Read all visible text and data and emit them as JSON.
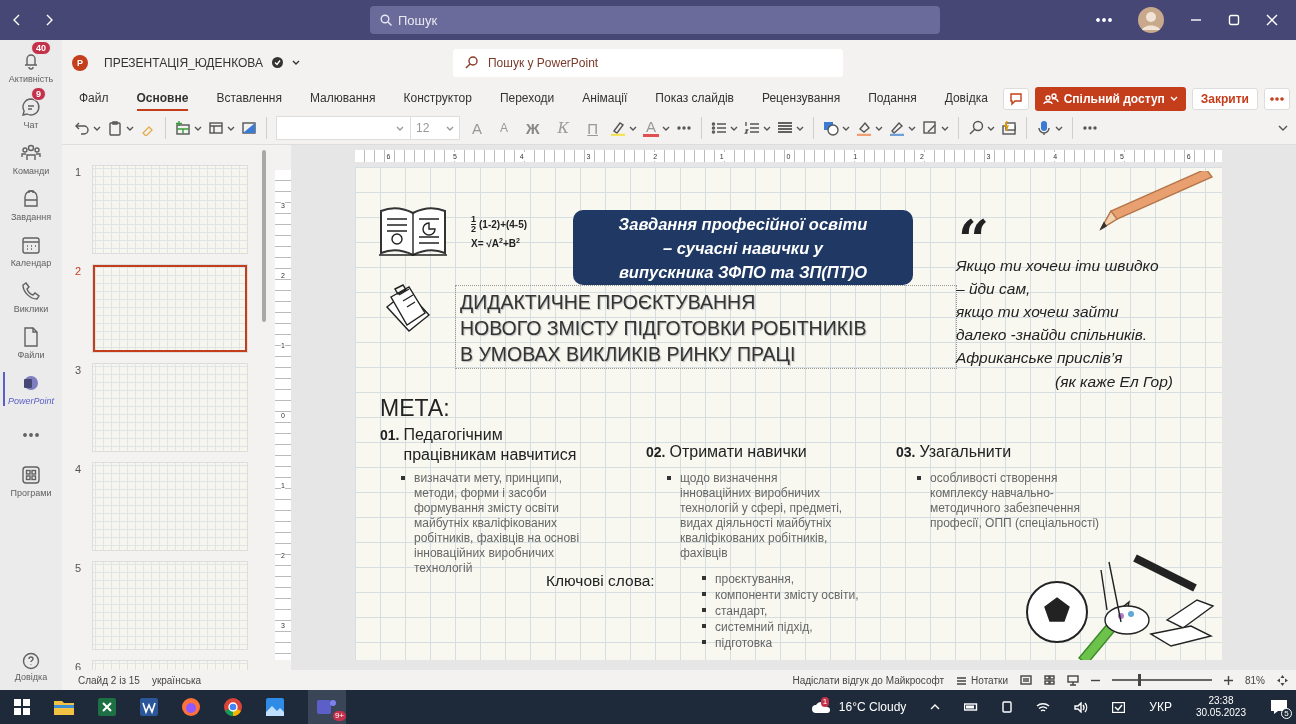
{
  "title_bar": {
    "search_placeholder": "Пошук"
  },
  "rail": {
    "items": [
      {
        "label": "Активність",
        "badge": "40",
        "selected": false
      },
      {
        "label": "Чат",
        "badge": "9",
        "selected": false
      },
      {
        "label": "Команди",
        "selected": false
      },
      {
        "label": "Завдання",
        "selected": false
      },
      {
        "label": "Календар",
        "selected": false
      },
      {
        "label": "Виклики",
        "selected": false
      },
      {
        "label": "Файли",
        "selected": false
      },
      {
        "label": "PowerPoint",
        "selected": true
      }
    ],
    "apps_label": "Програми",
    "help_label": "Довідка"
  },
  "app_header": {
    "logo_letter": "P",
    "file_name": "ПРЕЗЕНТАЦІЯ_ЮДЕНКОВА",
    "search_placeholder": "Пошук у PowerPoint"
  },
  "ribbon_tabs": [
    {
      "label": "Файл",
      "selected": false
    },
    {
      "label": "Основне",
      "selected": true
    },
    {
      "label": "Вставлення",
      "selected": false
    },
    {
      "label": "Малювання",
      "selected": false
    },
    {
      "label": "Конструктор",
      "selected": false
    },
    {
      "label": "Переходи",
      "selected": false
    },
    {
      "label": "Анімації",
      "selected": false
    },
    {
      "label": "Показ слайдів",
      "selected": false
    },
    {
      "label": "Рецензування",
      "selected": false
    },
    {
      "label": "Подання",
      "selected": false
    },
    {
      "label": "Довідка",
      "selected": false
    }
  ],
  "share_button": "Спільний доступ",
  "close_button": "Закрити",
  "toolbar": {
    "size_value": "12",
    "grow_font": "A",
    "shrink_font": "A",
    "bold": "Ж",
    "italic": "К",
    "underline": "П",
    "font_color": "A"
  },
  "thumbnails": [
    {
      "number": "1",
      "selected": false
    },
    {
      "number": "2",
      "selected": true
    },
    {
      "number": "3",
      "selected": false
    },
    {
      "number": "4",
      "selected": false
    },
    {
      "number": "5",
      "selected": false
    },
    {
      "number": "6",
      "selected": false
    }
  ],
  "rulers": {
    "horizontal": [
      "6",
      "5",
      "4",
      "3",
      "2",
      "1",
      "0",
      "1",
      "2",
      "3",
      "4",
      "5",
      "6"
    ],
    "vertical": [
      "3",
      "2",
      "1",
      "0",
      "1",
      "2",
      "3"
    ]
  },
  "slide": {
    "formula": {
      "numerator": "1",
      "denominator": "2",
      "line1": "(1-2)+(4-5)",
      "line2": "X= √A$^{2}$+B$^{2}$"
    },
    "banner": "Завдання професійної освіти\n– сучасні навички у\nвипускника ЗФПО та ЗП(ПТ)О",
    "heading": "ДИДАКТИЧНЕ ПРОЄКТУВАННЯ\nНОВОГО ЗМІСТУ ПІДГОТОВКИ РОБІТНИКІВ\nВ УМОВАХ ВИКЛИКІВ РИНКУ ПРАЦІ",
    "quote_mark": "“",
    "quote": "Якщо ти хочеш іти швидко\n– йди сам,\nякщо ти хочеш зайти\nдалеко -знайди спільників.\nАфриканське прислів’я",
    "quote_author": "(як каже Ел Гор)",
    "goal_title": "МЕТА:",
    "goals": [
      {
        "number": "01.",
        "title": "Педагогічним\nпрацівникам навчитися",
        "bullet": "визначати мету, принципи,\nметоди, форми і засоби\nформування змісту освіти\nмайбутніх кваліфікованих\nробітників, фахівців на основі\nінноваційних виробничих\nтехнологій"
      },
      {
        "number": "02.",
        "title": "Отримати навички",
        "bullet": "щодо визначення\nінноваційних виробничих\nтехнологій у сфері, предметі,\nвидах діяльності майбутніх\nкваліфікованих робітників,\nфахівців"
      },
      {
        "number": "03.",
        "title": "Узагальнити",
        "bullet": "особливості створення\nкомплексу навчально-\nметодичного забезпечення\nпрофесії, ОПП (спеціальності)"
      }
    ],
    "keywords_label": "Ключові слова:",
    "keywords": [
      "проєктування,",
      "компоненти змісту освіти,",
      "стандарт,",
      "системний підхід,",
      "підготовка"
    ]
  },
  "status_bar": {
    "slide_info": "Слайд 2 із 15",
    "language": "українська",
    "feedback": "Надіслати відгук до Майкрософт",
    "notes": "Нотатки",
    "zoom": {
      "level": 0.27,
      "reading": "81%"
    }
  },
  "taskbar": {
    "teams_badge": "9+",
    "weather_badge": "1",
    "weather": "16°C Cloudy",
    "language": "УКР",
    "time": "23:38",
    "date": "30.05.2023",
    "notifications": "5"
  }
}
